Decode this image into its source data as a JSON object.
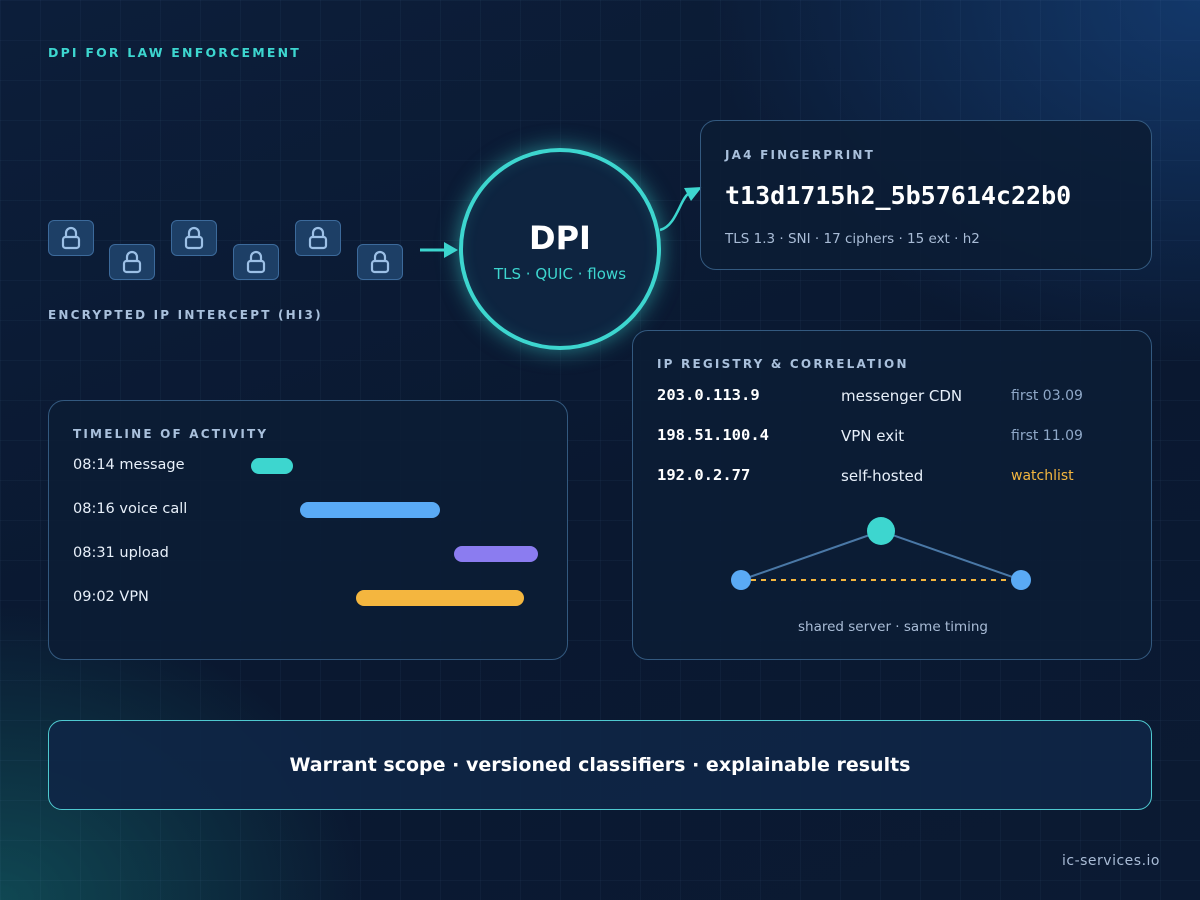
{
  "header": {
    "title": "DPI FOR LAW ENFORCEMENT"
  },
  "intercept": {
    "label": "ENCRYPTED IP INTERCEPT (HI3)"
  },
  "dpi": {
    "title": "DPI",
    "subtitle": "TLS · QUIC · flows"
  },
  "fingerprint": {
    "label": "JA4 FINGERPRINT",
    "value": "t13d1715h2_5b57614c22b0",
    "meta": "TLS 1.3 · SNI · 17 ciphers · 15 ext · h2"
  },
  "timeline": {
    "title": "TIMELINE OF ACTIVITY",
    "items": [
      {
        "label": "08:14 message",
        "color": "#3dd6cf"
      },
      {
        "label": "08:16 voice call",
        "color": "#5aaaf5"
      },
      {
        "label": "08:31 upload",
        "color": "#8b7cf0"
      },
      {
        "label": "09:02 VPN",
        "color": "#f4b63f"
      }
    ]
  },
  "registry": {
    "title": "IP REGISTRY & CORRELATION",
    "rows": [
      {
        "ip": "203.0.113.9",
        "desc": "messenger CDN",
        "status": "first 03.09"
      },
      {
        "ip": "198.51.100.4",
        "desc": "VPN exit",
        "status": "first 11.09"
      },
      {
        "ip": "192.0.2.77",
        "desc": "self-hosted",
        "status": "watchlist",
        "status_color": "#f4b63f"
      }
    ],
    "graph_caption": "shared server · same timing"
  },
  "banner": {
    "text": "Warrant scope · versioned classifiers · explainable results"
  },
  "footer": {
    "domain": "ic-services.io"
  },
  "colors": {
    "accent": "#3dd6cf",
    "blue": "#5aaaf5",
    "violet": "#8b7cf0",
    "amber": "#f4b63f"
  }
}
